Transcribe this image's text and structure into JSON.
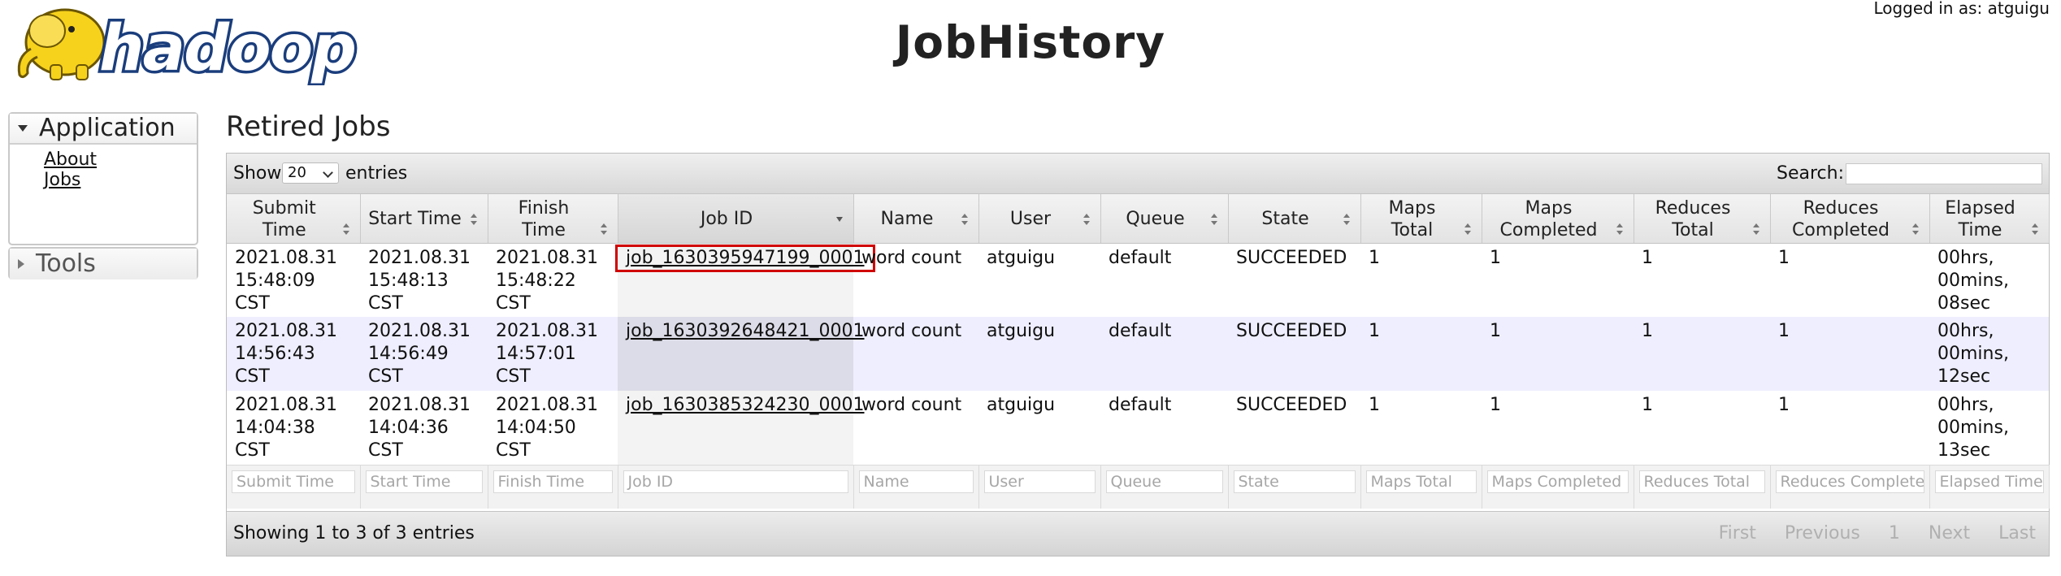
{
  "header": {
    "brand": "hadoop",
    "title": "JobHistory",
    "logged_in": "Logged in as: atguigu"
  },
  "sidebar": {
    "application": {
      "label": "Application",
      "links": [
        "About",
        "Jobs"
      ]
    },
    "tools": {
      "label": "Tools"
    }
  },
  "main": {
    "section_title": "Retired Jobs",
    "show_label": "Show",
    "show_value": "20",
    "entries_label": "entries",
    "search_label": "Search:",
    "search_value": "",
    "columns": [
      "Submit Time",
      "Start Time",
      "Finish Time",
      "Job ID",
      "Name",
      "User",
      "Queue",
      "State",
      "Maps Total",
      "Maps Completed",
      "Reduces Total",
      "Reduces Completed",
      "Elapsed Time"
    ],
    "rows": [
      {
        "submit": "2021.08.31 15:48:09 CST",
        "start": "2021.08.31 15:48:13 CST",
        "finish": "2021.08.31 15:48:22 CST",
        "job_id": "job_1630395947199_0001",
        "name": "word count",
        "user": "atguigu",
        "queue": "default",
        "state": "SUCCEEDED",
        "maps_total": "1",
        "maps_completed": "1",
        "reduces_total": "1",
        "reduces_completed": "1",
        "elapsed": "00hrs, 00mins, 08sec"
      },
      {
        "submit": "2021.08.31 14:56:43 CST",
        "start": "2021.08.31 14:56:49 CST",
        "finish": "2021.08.31 14:57:01 CST",
        "job_id": "job_1630392648421_0001",
        "name": "word count",
        "user": "atguigu",
        "queue": "default",
        "state": "SUCCEEDED",
        "maps_total": "1",
        "maps_completed": "1",
        "reduces_total": "1",
        "reduces_completed": "1",
        "elapsed": "00hrs, 00mins, 12sec"
      },
      {
        "submit": "2021.08.31 14:04:38 CST",
        "start": "2021.08.31 14:04:36 CST",
        "finish": "2021.08.31 14:04:50 CST",
        "job_id": "job_1630385324230_0001",
        "name": "word count",
        "user": "atguigu",
        "queue": "default",
        "state": "SUCCEEDED",
        "maps_total": "1",
        "maps_completed": "1",
        "reduces_total": "1",
        "reduces_completed": "1",
        "elapsed": "00hrs, 00mins, 13sec"
      }
    ],
    "filters": [
      "Submit Time",
      "Start Time",
      "Finish Time",
      "Job ID",
      "Name",
      "User",
      "Queue",
      "State",
      "Maps Total",
      "Maps Completed",
      "Reduces Total",
      "Reduces Completed",
      "Elapsed Time"
    ],
    "info": "Showing 1 to 3 of 3 entries",
    "pager": [
      "First",
      "Previous",
      "1",
      "Next",
      "Last"
    ]
  },
  "colors": {
    "logo_yellow": "#f7d21c",
    "logo_blue": "#1a3d7c",
    "highlight_box": "#d00000",
    "row_even": "#eeeeff"
  }
}
